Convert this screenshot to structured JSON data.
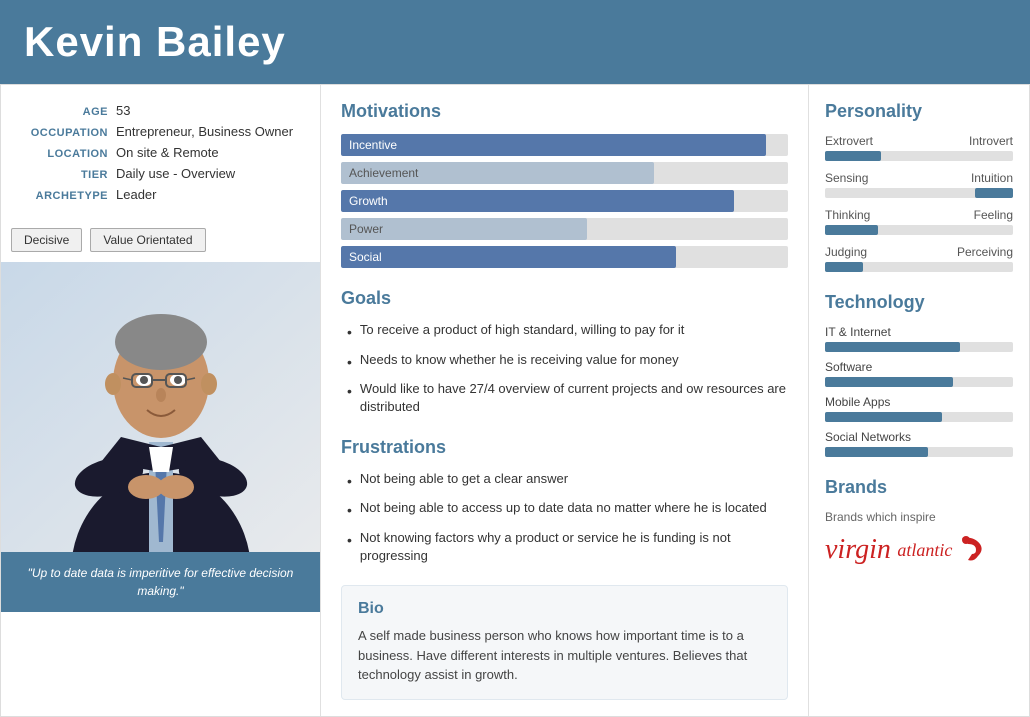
{
  "header": {
    "name": "Kevin Bailey"
  },
  "profile": {
    "age_label": "AGE",
    "age_value": "53",
    "occupation_label": "OCCUPATION",
    "occupation_value": "Entrepreneur, Business Owner",
    "location_label": "LOCATION",
    "location_value": "On site & Remote",
    "tier_label": "TIER",
    "tier_value": "Daily use - Overview",
    "archetype_label": "ARCHETYPE",
    "archetype_value": "Leader",
    "tag1": "Decisive",
    "tag2": "Value Orientated",
    "quote": "\"Up to date data is imperitive for effective decision making.\""
  },
  "motivations": {
    "title": "Motivations",
    "bars": [
      {
        "label": "Incentive",
        "width": 95,
        "filled": true
      },
      {
        "label": "Achievement",
        "width": 70,
        "filled": false
      },
      {
        "label": "Growth",
        "width": 88,
        "filled": true
      },
      {
        "label": "Power",
        "width": 55,
        "filled": false
      },
      {
        "label": "Social",
        "width": 75,
        "filled": true
      }
    ]
  },
  "goals": {
    "title": "Goals",
    "items": [
      "To receive a product of high standard, willing to pay for it",
      "Needs to know whether he is receiving value for money",
      "Would like to have 27/4 overview of current projects and ow resources are distributed"
    ]
  },
  "frustrations": {
    "title": "Frustrations",
    "items": [
      "Not being able to get a clear answer",
      "Not being able to access up to date data no matter where he is located",
      "Not knowing factors why a product or service he is funding is not progressing"
    ]
  },
  "bio": {
    "title": "Bio",
    "text": "A self made business person who knows how important time is to a business. Have different interests in multiple ventures. Believes that technology assist in growth."
  },
  "personality": {
    "title": "Personality",
    "traits": [
      {
        "left": "Extrovert",
        "right": "Introvert",
        "fill_left": true,
        "fill_pct": 30
      },
      {
        "left": "Sensing",
        "right": "Intuition",
        "fill_left": false,
        "fill_pct": 80
      },
      {
        "left": "Thinking",
        "right": "Feeling",
        "fill_left": true,
        "fill_pct": 28
      },
      {
        "left": "Judging",
        "right": "Perceiving",
        "fill_left": true,
        "fill_pct": 20
      }
    ]
  },
  "technology": {
    "title": "Technology",
    "items": [
      {
        "label": "IT & Internet",
        "pct": 72
      },
      {
        "label": "Software",
        "pct": 68
      },
      {
        "label": "Mobile Apps",
        "pct": 62
      },
      {
        "label": "Social Networks",
        "pct": 55
      }
    ]
  },
  "brands": {
    "title": "Brands",
    "subtitle": "Brands which inspire",
    "brand_name": "virgin atlantic"
  }
}
